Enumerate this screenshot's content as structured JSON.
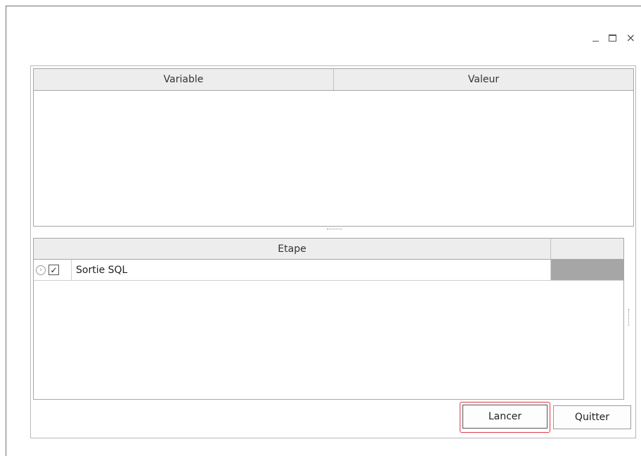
{
  "window": {
    "controls": {
      "minimize": "minimize-icon",
      "maximize": "maximize-icon",
      "close": "×"
    }
  },
  "variables_grid": {
    "columns": [
      "Variable",
      "Valeur"
    ],
    "rows": []
  },
  "steps_grid": {
    "columns": [
      "Etape",
      ""
    ],
    "rows": [
      {
        "checked": true,
        "label": "Sortie SQL"
      }
    ]
  },
  "buttons": {
    "run": "Lancer",
    "quit": "Quitter"
  },
  "colors": {
    "focus_outline": "#e03a4a",
    "row_extra_cell": "#a6a6a6",
    "header_bg": "#ededed"
  }
}
